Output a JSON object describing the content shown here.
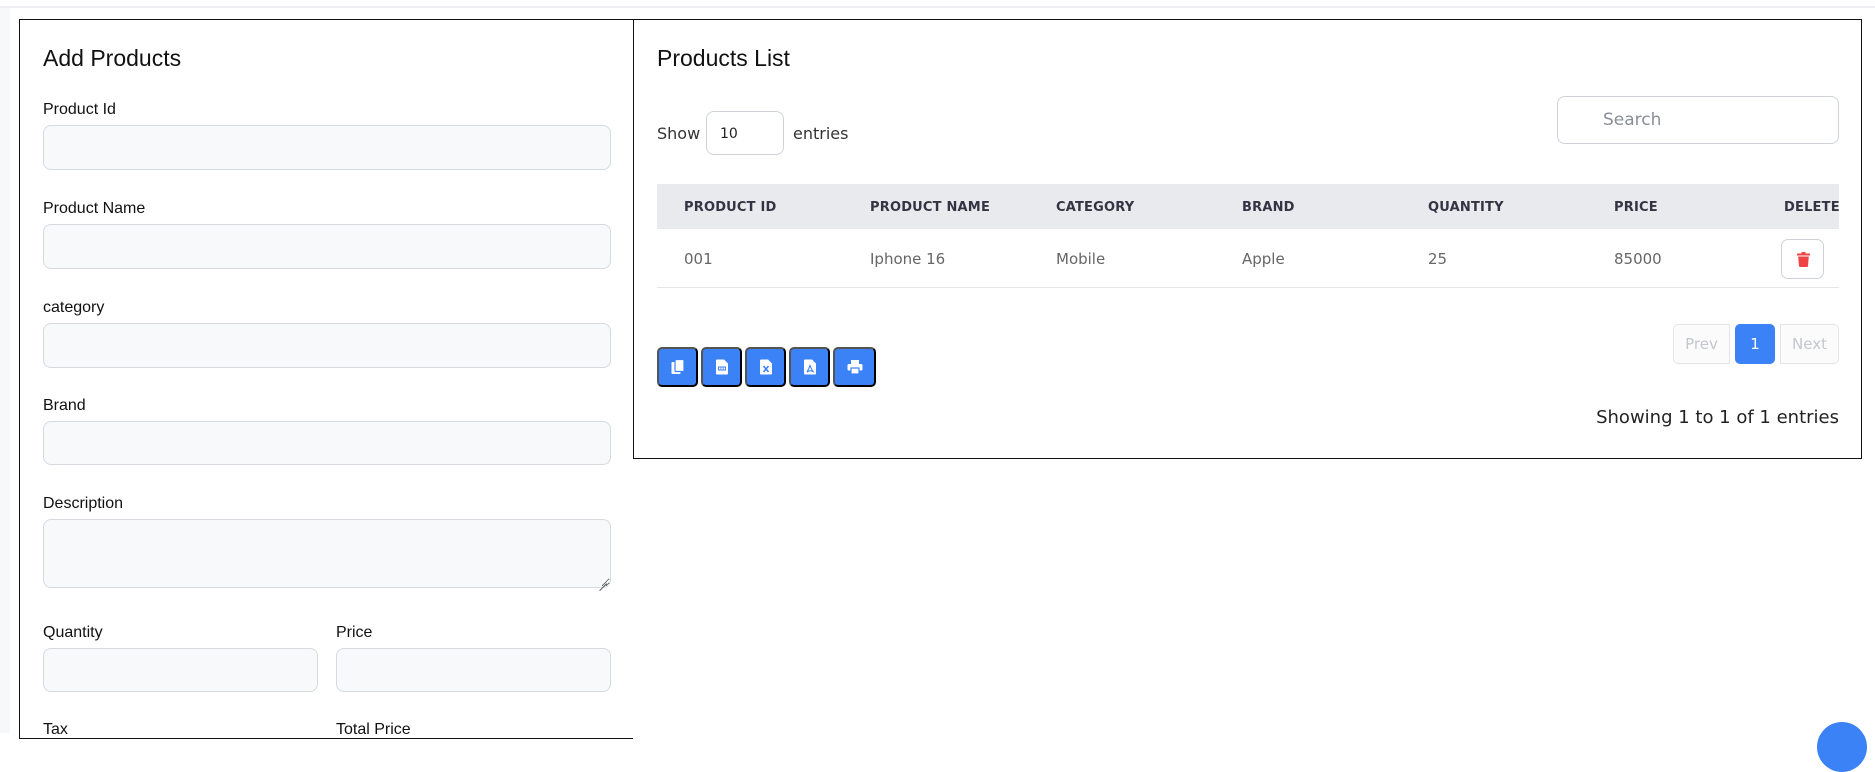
{
  "add_form": {
    "title": "Add Products",
    "labels": {
      "product_id": "Product Id",
      "product_name": "Product Name",
      "category": "category",
      "brand": "Brand",
      "description": "Description",
      "quantity": "Quantity",
      "price": "Price",
      "tax": "Tax",
      "total_price": "Total Price"
    },
    "values": {
      "product_id": "",
      "product_name": "",
      "category": "",
      "brand": "",
      "description": "",
      "quantity": "",
      "price": ""
    }
  },
  "list": {
    "title": "Products List",
    "show_label": "Show",
    "entries_value": "10",
    "entries_label": "entries",
    "search_placeholder": "Search",
    "columns": [
      "PRODUCT ID",
      "PRODUCT NAME",
      "CATEGORY",
      "BRAND",
      "QUANTITY",
      "PRICE",
      "DELETE"
    ],
    "rows": [
      {
        "id": "001",
        "name": "Iphone 16",
        "category": "Mobile",
        "brand": "Apple",
        "quantity": "25",
        "price": "85000"
      }
    ],
    "export_icons": [
      "copy-icon",
      "csv-icon",
      "excel-icon",
      "pdf-icon",
      "print-icon"
    ],
    "pagination": {
      "prev": "Prev",
      "current": "1",
      "next": "Next"
    },
    "showing_text": "Showing 1 to 1 of 1 entries"
  },
  "colors": {
    "primary": "#3b82f6",
    "danger": "#ef4444",
    "header_bg": "#e8eaed"
  }
}
